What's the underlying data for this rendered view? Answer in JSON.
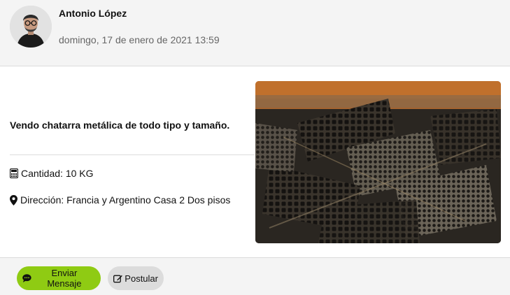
{
  "post": {
    "author": "Antonio López",
    "date": "domingo, 17 de enero de 2021 13:59",
    "title": "Vendo chatarra metálica de todo tipo y tamaño.",
    "quantity": "Cantidad: 10 KG",
    "address": "Dirección: Francia y Argentino Casa 2 Dos pisos"
  },
  "actions": {
    "message_label": "Enviar Mensaje",
    "apply_label": "Postular"
  },
  "icons": {
    "quantity": "calculator-icon",
    "address": "map-marker-icon",
    "message": "comment-dots-icon",
    "apply": "edit-icon"
  },
  "colors": {
    "primary_button": "#8fcb13",
    "secondary_button": "#dcdcdc",
    "header_bg": "#f4f4f4",
    "muted_text": "#666666"
  }
}
